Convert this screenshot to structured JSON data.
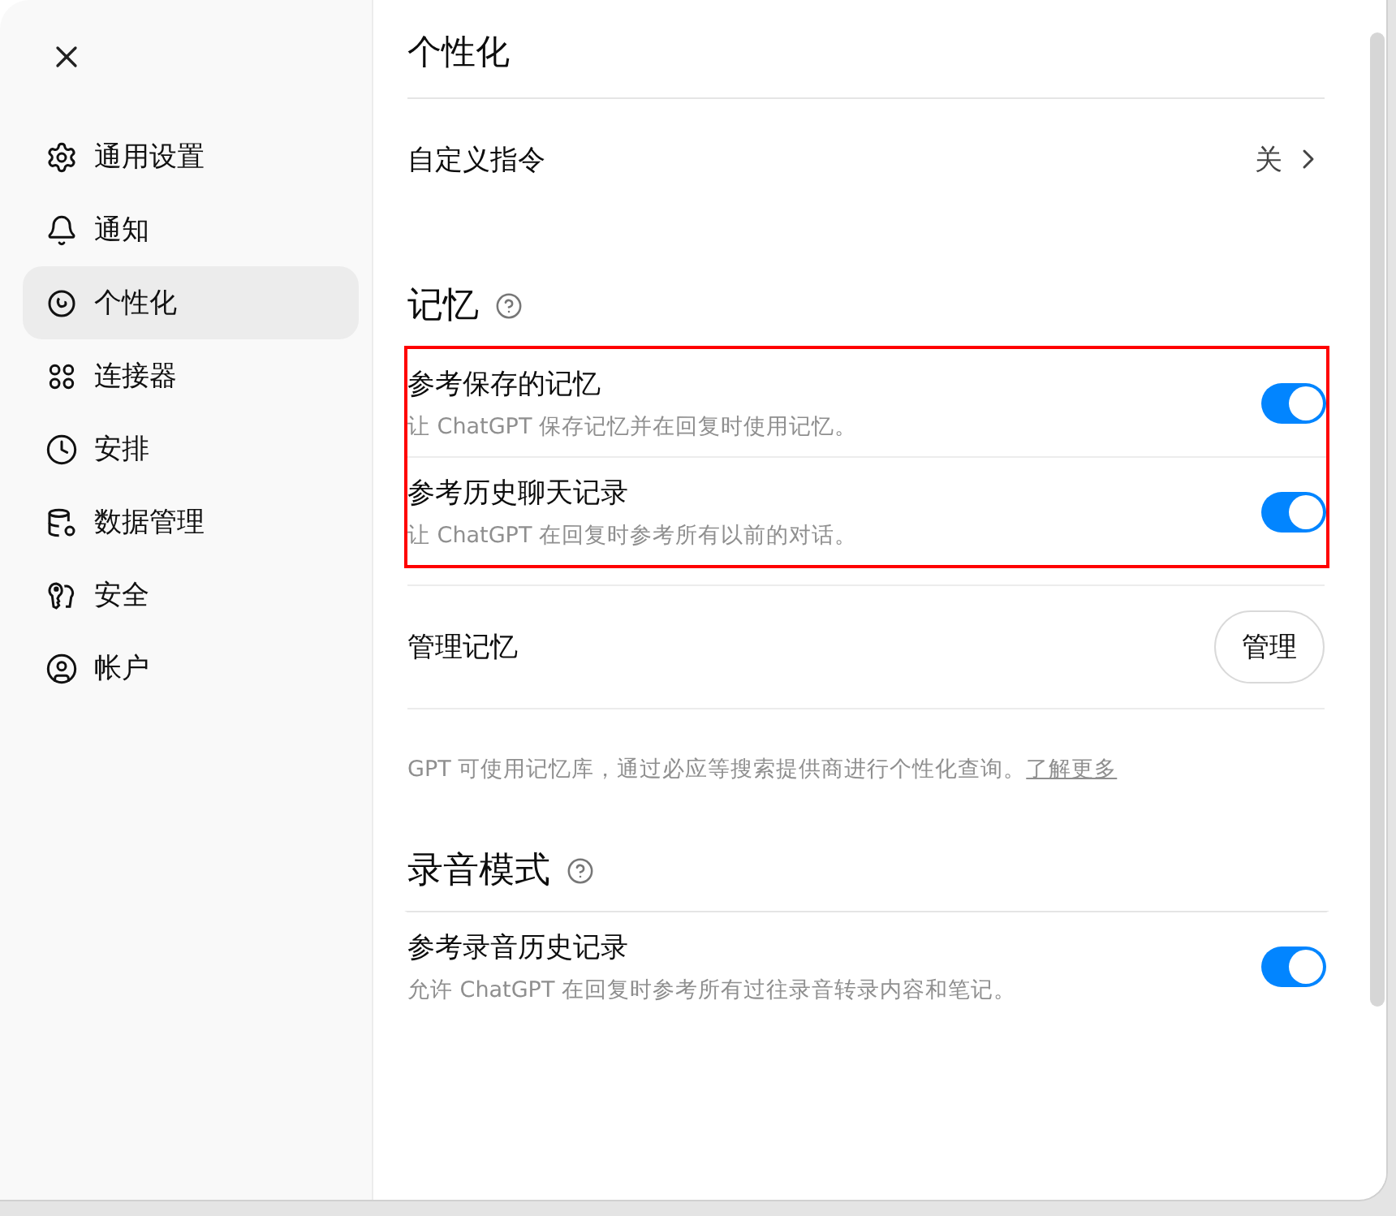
{
  "sidebar": {
    "items": [
      {
        "label": "通用设置",
        "selected": false
      },
      {
        "label": "通知",
        "selected": false
      },
      {
        "label": "个性化",
        "selected": true
      },
      {
        "label": "连接器",
        "selected": false
      },
      {
        "label": "安排",
        "selected": false
      },
      {
        "label": "数据管理",
        "selected": false
      },
      {
        "label": "安全",
        "selected": false
      },
      {
        "label": "帐户",
        "selected": false
      }
    ]
  },
  "main": {
    "title": "个性化",
    "custom_instructions": {
      "label": "自定义指令",
      "value": "关"
    },
    "sections": [
      {
        "title": "记忆",
        "highlighted": true,
        "toggles": [
          {
            "label": "参考保存的记忆",
            "description": "让 ChatGPT 保存记忆并在回复时使用记忆。",
            "on": true
          },
          {
            "label": "参考历史聊天记录",
            "description": "让 ChatGPT 在回复时参考所有以前的对话。",
            "on": true
          }
        ],
        "manage": {
          "label": "管理记忆",
          "button": "管理"
        },
        "note": {
          "text": "GPT 可使用记忆库，通过必应等搜索提供商进行个性化查询。",
          "link": "了解更多"
        }
      },
      {
        "title": "录音模式",
        "highlighted": false,
        "toggles": [
          {
            "label": "参考录音历史记录",
            "description": "允许 ChatGPT 在回复时参考所有过往录音转录内容和笔记。",
            "on": true
          }
        ]
      }
    ]
  }
}
